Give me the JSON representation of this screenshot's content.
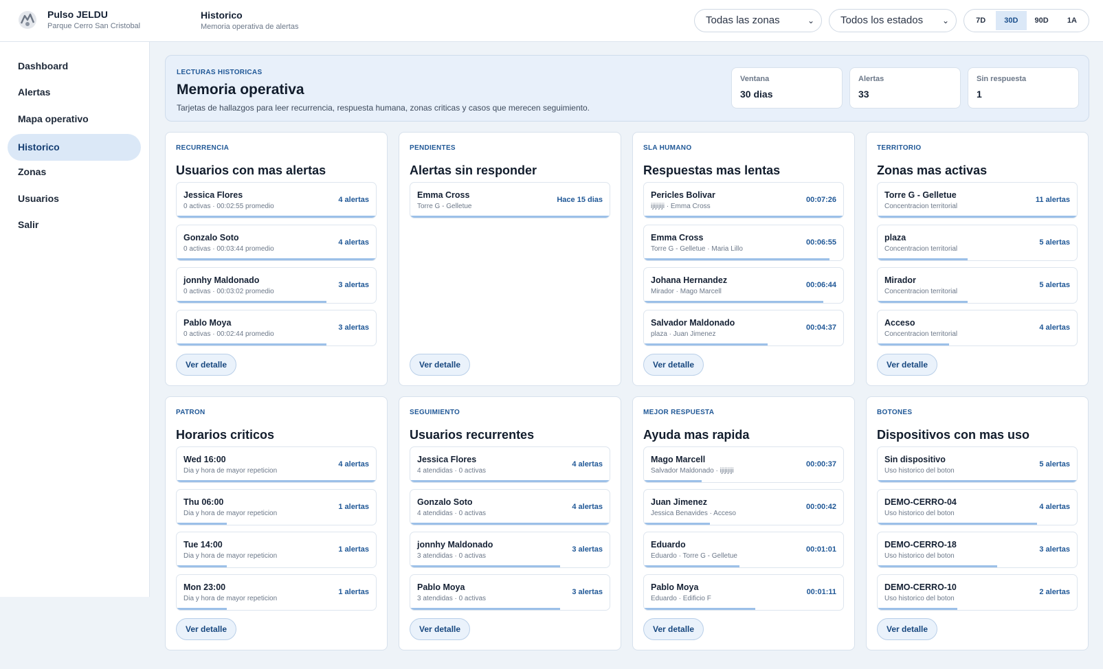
{
  "brand": {
    "title": "Pulso JELDU",
    "subtitle": "Parque Cerro San Cristobal"
  },
  "page": {
    "title": "Historico",
    "subtitle": "Memoria operativa de alertas"
  },
  "filters": {
    "zone": "Todas las zonas",
    "status": "Todos los estados"
  },
  "ranges": [
    {
      "label": "7D",
      "active": false
    },
    {
      "label": "30D",
      "active": true
    },
    {
      "label": "90D",
      "active": false
    },
    {
      "label": "1A",
      "active": false
    }
  ],
  "nav": [
    {
      "label": "Dashboard",
      "active": false
    },
    {
      "label": "Alertas",
      "active": false
    },
    {
      "label": "Mapa operativo",
      "active": false
    },
    {
      "label": "Historico",
      "active": true
    },
    {
      "label": "Zonas",
      "active": false
    },
    {
      "label": "Usuarios",
      "active": false
    },
    {
      "label": "Salir",
      "active": false
    }
  ],
  "hero": {
    "eyebrow": "LECTURAS HISTORICAS",
    "title": "Memoria operativa",
    "description": "Tarjetas de hallazgos para leer recurrencia, respuesta humana, zonas criticas y casos que merecen seguimiento.",
    "stats": [
      {
        "label": "Ventana",
        "value": "30 dias"
      },
      {
        "label": "Alertas",
        "value": "33"
      },
      {
        "label": "Sin respuesta",
        "value": "1"
      }
    ]
  },
  "button_label": "Ver detalle",
  "cards": [
    {
      "eyebrow": "RECURRENCIA",
      "title": "Usuarios con mas alertas",
      "rows": [
        {
          "name": "Jessica Flores",
          "meta": "0 activas · 00:02:55 promedio",
          "value": "4 alertas",
          "level": 1.0
        },
        {
          "name": "Gonzalo Soto",
          "meta": "0 activas · 00:03:44 promedio",
          "value": "4 alertas",
          "level": 1.0
        },
        {
          "name": "jonnhy Maldonado",
          "meta": "0 activas · 00:03:02 promedio",
          "value": "3 alertas",
          "level": 0.75
        },
        {
          "name": "Pablo Moya",
          "meta": "0 activas · 00:02:44 promedio",
          "value": "3 alertas",
          "level": 0.75
        }
      ]
    },
    {
      "eyebrow": "PENDIENTES",
      "title": "Alertas sin responder",
      "rows": [
        {
          "name": "Emma Cross",
          "meta": "Torre G - Gelletue",
          "value": "Hace 15 dias",
          "level": 1.0
        }
      ]
    },
    {
      "eyebrow": "SLA HUMANO",
      "title": "Respuestas mas lentas",
      "rows": [
        {
          "name": "Pericles Bolivar",
          "meta": "ijijijiji · Emma Cross",
          "value": "00:07:26",
          "level": 1.0
        },
        {
          "name": "Emma Cross",
          "meta": "Torre G - Gelletue · Maria Lillo",
          "value": "00:06:55",
          "level": 0.93
        },
        {
          "name": "Johana Hernandez",
          "meta": "Mirador · Mago Marcell",
          "value": "00:06:44",
          "level": 0.9
        },
        {
          "name": "Salvador Maldonado",
          "meta": "plaza · Juan Jimenez",
          "value": "00:04:37",
          "level": 0.62
        }
      ]
    },
    {
      "eyebrow": "TERRITORIO",
      "title": "Zonas mas activas",
      "rows": [
        {
          "name": "Torre G - Gelletue",
          "meta": "Concentracion territorial",
          "value": "11 alertas",
          "level": 1.0
        },
        {
          "name": "plaza",
          "meta": "Concentracion territorial",
          "value": "5 alertas",
          "level": 0.45
        },
        {
          "name": "Mirador",
          "meta": "Concentracion territorial",
          "value": "5 alertas",
          "level": 0.45
        },
        {
          "name": "Acceso",
          "meta": "Concentracion territorial",
          "value": "4 alertas",
          "level": 0.36
        }
      ]
    },
    {
      "eyebrow": "PATRON",
      "title": "Horarios criticos",
      "rows": [
        {
          "name": "Wed 16:00",
          "meta": "Dia y hora de mayor repeticion",
          "value": "4 alertas",
          "level": 1.0
        },
        {
          "name": "Thu 06:00",
          "meta": "Dia y hora de mayor repeticion",
          "value": "1 alertas",
          "level": 0.25
        },
        {
          "name": "Tue 14:00",
          "meta": "Dia y hora de mayor repeticion",
          "value": "1 alertas",
          "level": 0.25
        },
        {
          "name": "Mon 23:00",
          "meta": "Dia y hora de mayor repeticion",
          "value": "1 alertas",
          "level": 0.25
        }
      ]
    },
    {
      "eyebrow": "SEGUIMIENTO",
      "title": "Usuarios recurrentes",
      "rows": [
        {
          "name": "Jessica Flores",
          "meta": "4 atendidas · 0 activas",
          "value": "4 alertas",
          "level": 1.0
        },
        {
          "name": "Gonzalo Soto",
          "meta": "4 atendidas · 0 activas",
          "value": "4 alertas",
          "level": 1.0
        },
        {
          "name": "jonnhy Maldonado",
          "meta": "3 atendidas · 0 activas",
          "value": "3 alertas",
          "level": 0.75
        },
        {
          "name": "Pablo Moya",
          "meta": "3 atendidas · 0 activas",
          "value": "3 alertas",
          "level": 0.75
        }
      ]
    },
    {
      "eyebrow": "MEJOR RESPUESTA",
      "title": "Ayuda mas rapida",
      "rows": [
        {
          "name": "Mago Marcell",
          "meta": "Salvador Maldonado · ijijijiji",
          "value": "00:00:37",
          "level": 0.29
        },
        {
          "name": "Juan Jimenez",
          "meta": "Jessica Benavides · Acceso",
          "value": "00:00:42",
          "level": 0.33
        },
        {
          "name": "Eduardo",
          "meta": "Eduardo · Torre G - Gelletue",
          "value": "00:01:01",
          "level": 0.48
        },
        {
          "name": "Pablo Moya",
          "meta": "Eduardo · Edificio F",
          "value": "00:01:11",
          "level": 0.56
        }
      ]
    },
    {
      "eyebrow": "BOTONES",
      "title": "Dispositivos con mas uso",
      "rows": [
        {
          "name": "Sin dispositivo",
          "meta": "Uso historico del boton",
          "value": "5 alertas",
          "level": 1.0
        },
        {
          "name": "DEMO-CERRO-04",
          "meta": "Uso historico del boton",
          "value": "4 alertas",
          "level": 0.8
        },
        {
          "name": "DEMO-CERRO-18",
          "meta": "Uso historico del boton",
          "value": "3 alertas",
          "level": 0.6
        },
        {
          "name": "DEMO-CERRO-10",
          "meta": "Uso historico del boton",
          "value": "2 alertas",
          "level": 0.4
        }
      ]
    }
  ]
}
